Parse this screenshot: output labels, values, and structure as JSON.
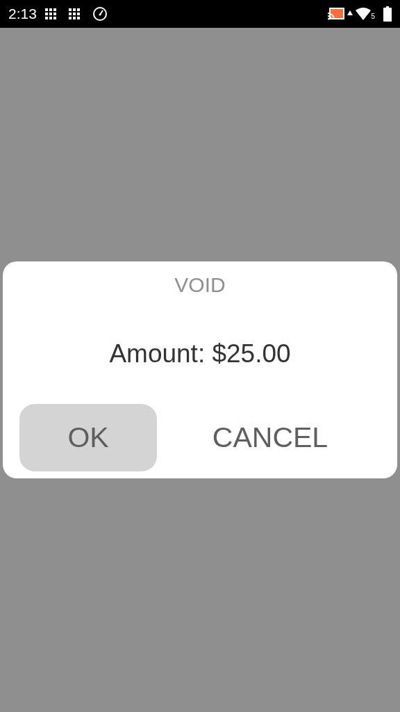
{
  "status_bar": {
    "time": "2:13",
    "wifi_badge": "5"
  },
  "dialog": {
    "title": "VOID",
    "message": "Amount: $25.00",
    "buttons": [
      {
        "label": "OK",
        "selected": true
      },
      {
        "label": "CANCEL",
        "selected": false
      }
    ]
  }
}
